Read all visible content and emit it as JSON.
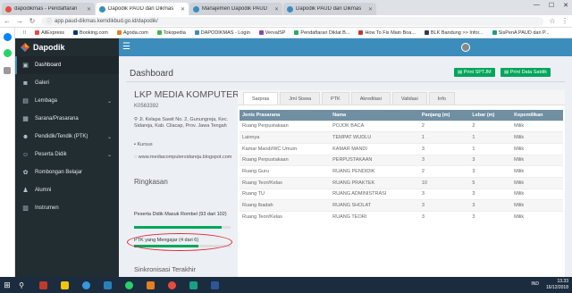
{
  "browser": {
    "tabs": [
      {
        "label": "dapodikmas - Pendaftaran",
        "color": "#e74c3c",
        "active": false
      },
      {
        "label": "Dapodik PAUD dan Dikmas",
        "color": "#3c8dbc",
        "active": true
      },
      {
        "label": "Manajemen Dapodik PAUD",
        "color": "#3c8dbc",
        "active": false
      },
      {
        "label": "Dapodik PAUD dan Dikmas",
        "color": "#3c8dbc",
        "active": false
      }
    ],
    "url": "app.paud-dikmas.kemdikbud.go.id/dapodik/",
    "bookmarks": [
      "AliExpress",
      "Booking.com",
      "Agoda.com",
      "Tokopedia",
      "DAPODIKMAS - Login",
      "VervalSP",
      "Pendaftaran Diklat B...",
      "How To Fix Main Boa...",
      "BLK Bandung >> Infor...",
      "SisPenA PAUD dan P..."
    ]
  },
  "app": {
    "brand": "Dapodik",
    "accent": "#3c8dbc",
    "sidebar_bg": "#222d32"
  },
  "sidebar": {
    "items": [
      {
        "label": "Dashboard",
        "icon": "dashboard-icon",
        "glyph": "▣",
        "chevron": false
      },
      {
        "label": "Galeri",
        "icon": "camera-icon",
        "glyph": "◙",
        "chevron": false
      },
      {
        "label": "Lembaga",
        "icon": "briefcase-icon",
        "glyph": "▤",
        "chevron": true
      },
      {
        "label": "Sarana/Prasarana",
        "icon": "folder-icon",
        "glyph": "▦",
        "chevron": false
      },
      {
        "label": "Pendidik/Tendik (PTK)",
        "icon": "users-icon",
        "glyph": "☻",
        "chevron": true
      },
      {
        "label": "Peserta Didik",
        "icon": "student-icon",
        "glyph": "☺",
        "chevron": true
      },
      {
        "label": "Rombongan Belajar",
        "icon": "group-icon",
        "glyph": "✿",
        "chevron": false
      },
      {
        "label": "Alumni",
        "icon": "graduate-icon",
        "glyph": "♟",
        "chevron": false
      },
      {
        "label": "Instrumen",
        "icon": "book-icon",
        "glyph": "▥",
        "chevron": false
      }
    ]
  },
  "content": {
    "heading": "Dashboard",
    "buttons": {
      "print_sptjm": "Print SPTJM",
      "print_data_satdik": "Print Data Satdik"
    },
    "lembaga": {
      "name": "LKP MEDIA KOMPUTER",
      "code": "K0563392",
      "address": "Jl. Kelapa Sawit No. 2, Gunungreja, Kec. Sidareja, Kab. Cilacap, Prov. Jawa Tengah",
      "type": "Kursus",
      "website": "www.mediacomputersidareja.blogspot.com"
    },
    "ringkasan": {
      "title": "Ringkasan",
      "peserta_didik": "Peserta Didik Masuk Rombel (93 dari 102)",
      "peserta_progress": 0.91,
      "ptk": "PTK yang Mengajar (4 dari 6)",
      "ptk_progress": 0.67
    },
    "sinkronisasi": "Sinkronisasi Terakhir"
  },
  "panel": {
    "tabs": [
      "Sarpras",
      "Jml Siswa",
      "PTK",
      "Akreditasi",
      "Validasi",
      "Info"
    ],
    "active_tab": 0,
    "columns": [
      "Jenis Prasarana",
      "Nama",
      "Panjang (m)",
      "Lebar (m)",
      "Kepemilikan"
    ],
    "rows": [
      [
        "Ruang Perpustakaan",
        "POJOK BACA",
        "2",
        "2",
        "Milik"
      ],
      [
        "Lainnya",
        "TEMPAT WUDLU",
        "1",
        "1",
        "Milik"
      ],
      [
        "Kamar Mandi/WC Umum",
        "KAMAR MANDI",
        "3",
        "1",
        "Milik"
      ],
      [
        "Ruang Perpustakaan",
        "PERPUSTAKAAN",
        "3",
        "3",
        "Milik"
      ],
      [
        "Ruang Guru",
        "RUANG PENDIDIK",
        "2",
        "3",
        "Milik"
      ],
      [
        "Ruang Teori/Kelas",
        "RUANG PRAKTEK",
        "10",
        "5",
        "Milik"
      ],
      [
        "Ruang TU",
        "RUANG ADMINISTRASI",
        "3",
        "3",
        "Milik"
      ],
      [
        "Ruang Ibadah",
        "RUANG SHOLAT",
        "3",
        "3",
        "Milik"
      ],
      [
        "Ruang Teori/Kelas",
        "RUANG TEORI",
        "3",
        "3",
        "Milik"
      ]
    ]
  },
  "taskbar": {
    "icons": [
      "file-explorer-icon",
      "edge-icon",
      "store-icon",
      "chrome-icon",
      "whatsapp-icon",
      "word-icon"
    ],
    "lang": "IND",
    "time": "13.33",
    "date": "16/12/2018"
  }
}
